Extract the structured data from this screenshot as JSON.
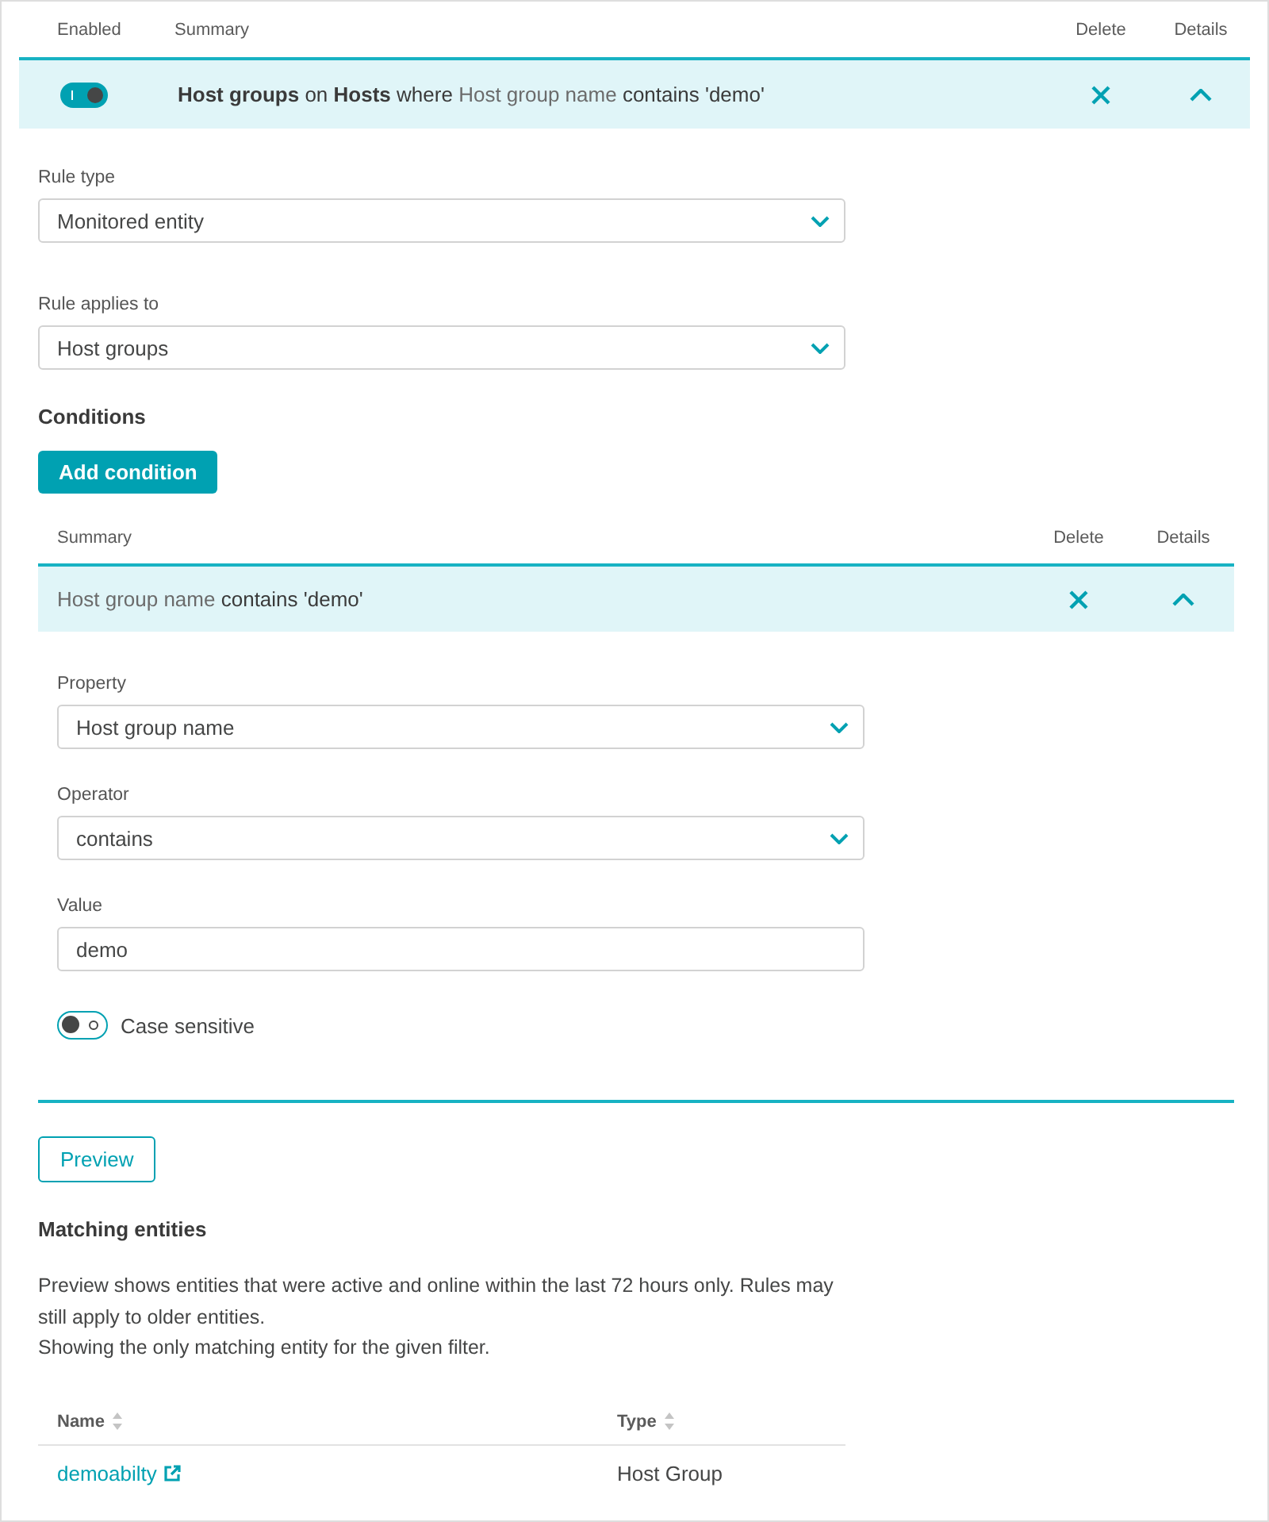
{
  "rules": {
    "columns": [
      "Enabled",
      "Summary",
      "Delete",
      "Details"
    ],
    "rows": [
      {
        "enabled": true,
        "expanded": true,
        "summary": [
          {
            "text": "Host groups",
            "kind": "bold"
          },
          {
            "text": "on",
            "kind": "plain"
          },
          {
            "text": "Hosts",
            "kind": "bold"
          },
          {
            "text": "where",
            "kind": "plain"
          },
          {
            "text": "Host group name",
            "kind": "muted"
          },
          {
            "text": "contains 'demo'",
            "kind": "plain"
          }
        ],
        "details": {
          "fields": [
            {
              "kind": "select",
              "label": "Rule type",
              "value": "Monitored entity"
            },
            {
              "kind": "select",
              "label": "Rule applies to",
              "value": "Host groups"
            }
          ],
          "conditions": {
            "title": "Conditions",
            "add_button": "Add condition",
            "columns": [
              "Summary",
              "Delete",
              "Details"
            ],
            "rows": [
              {
                "expanded": true,
                "summary": [
                  {
                    "text": "Host group name",
                    "kind": "muted"
                  },
                  {
                    "text": "contains 'demo'",
                    "kind": "plain"
                  }
                ],
                "details": {
                  "fields": [
                    {
                      "kind": "select",
                      "label": "Property",
                      "value": "Host group name"
                    },
                    {
                      "kind": "select",
                      "label": "Operator",
                      "value": "contains"
                    },
                    {
                      "kind": "text",
                      "label": "Value",
                      "value": "demo"
                    }
                  ],
                  "case_sensitive": {
                    "label": "Case sensitive",
                    "on": false
                  }
                }
              }
            ]
          },
          "preview_button": "Preview",
          "matching_entities": {
            "title": "Matching entities",
            "description": "Preview shows entities that were active and online within the last 72 hours only. Rules may still apply to older entities.",
            "note": "Showing the only matching entity for the given filter.",
            "columns": [
              "Name",
              "Type"
            ],
            "rows": [
              {
                "name": "demoabilty",
                "type": "Host Group"
              }
            ]
          }
        }
      }
    ]
  }
}
